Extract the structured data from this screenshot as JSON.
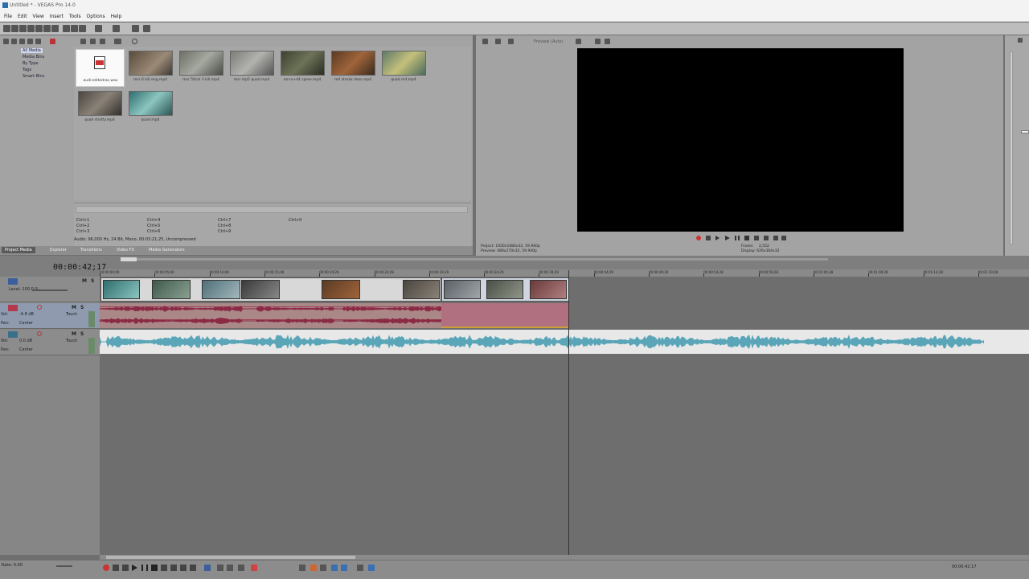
{
  "window": {
    "title": "Untitled * - VEGAS Pro 14.0"
  },
  "menu": [
    "File",
    "Edit",
    "View",
    "Insert",
    "Tools",
    "Options",
    "Help"
  ],
  "media_tree": [
    "All Media",
    "Media Bins",
    "By Type",
    "Tags",
    "Smart Bins"
  ],
  "media_files": [
    {
      "name": "audi-editedrac.wav",
      "type": "audio"
    },
    {
      "name": "msr 6 kill eng.mp4",
      "type": "video"
    },
    {
      "name": "msr 50cal 3 kill.mp4",
      "type": "video"
    },
    {
      "name": "msr mp5 quad.mp4",
      "type": "video"
    },
    {
      "name": "mrvv+44 spree.mp4",
      "type": "video"
    },
    {
      "name": "m4 streak dess.mp4",
      "type": "video"
    },
    {
      "name": "quad m4.mp4",
      "type": "video"
    },
    {
      "name": "quad shotty.mp4",
      "type": "video"
    },
    {
      "name": "quad.mp4",
      "type": "video"
    }
  ],
  "shortcuts": [
    "Ctrl+1",
    "Ctrl+2",
    "Ctrl+3",
    "Ctrl+4",
    "Ctrl+5",
    "Ctrl+6",
    "Ctrl+7",
    "Ctrl+8",
    "Ctrl+9",
    "Ctrl+0"
  ],
  "media_info": "Audio: 96,000 Hz, 24 Bit, Mono, 00:03:21;25, Uncompressed",
  "tabs": [
    "Project Media",
    "Explorer",
    "Transitions",
    "Video FX",
    "Media Generators"
  ],
  "preview": {
    "mode": "Preview (Auto)",
    "project": "Project: 1920x1080x32, 59.940p",
    "preview": "Preview: 480x270x32, 59.940p",
    "frame_label": "Frame:",
    "frame": "2,552",
    "display": "Display: 626x364x32"
  },
  "timeline": {
    "timecode": "00:00:42;17",
    "ruler": [
      "00:00:00;00",
      "00:00:05;00",
      "00:00:10;00",
      "00:00:15;00",
      "00:00:19;29",
      "00:00:24;29",
      "00:00:29;29",
      "00:00:34;29",
      "00:00:39;29",
      "00:00:44;29",
      "00:00:49;29",
      "00:00:54;28",
      "00:00:59;28",
      "00:01:04;28",
      "00:01:09;28",
      "00:01:14;28",
      "00:01:19;28"
    ],
    "video_track": {
      "level": "Level: 100.0 %"
    },
    "audio_track1": {
      "vol": "Vol:",
      "vol_value": "-4.8 dB",
      "pan": "Pan:",
      "pan_value": "Center",
      "mode": "Touch"
    },
    "audio_track2": {
      "vol": "Vol:",
      "vol_value": "0.0 dB",
      "pan": "Pan:",
      "pan_value": "Center",
      "mode": "Touch"
    }
  },
  "status": {
    "rate_label": "Rate: 0.00",
    "bottom_timecode": "00:00:42;17"
  },
  "colors": {
    "audio1": "#b17b86",
    "audio2": "#5aa6b8",
    "background": "#6f6f6f"
  }
}
